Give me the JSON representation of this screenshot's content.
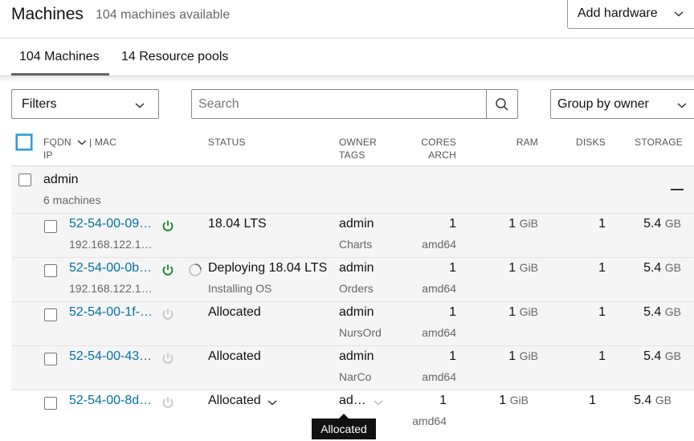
{
  "header": {
    "title": "Machines",
    "subtitle": "104 machines available",
    "add_hardware_label": "Add hardware"
  },
  "tabs": [
    {
      "label": "104 Machines",
      "active": true
    },
    {
      "label": "14 Resource pools",
      "active": false
    }
  ],
  "toolbar": {
    "filters_label": "Filters",
    "search_placeholder": "Search",
    "group_by_label": "Group by owner"
  },
  "table_header": {
    "fqdn": "FQDN",
    "mac": "| MAC",
    "ip": "IP",
    "status": "STATUS",
    "owner": "OWNER",
    "tags": "TAGS",
    "cores": "CORES",
    "arch": "ARCH",
    "ram": "RAM",
    "disks": "DISKS",
    "storage": "STORAGE"
  },
  "group": {
    "name": "admin",
    "count": "6 machines"
  },
  "rows": [
    {
      "fqdn": "52-54-00-09…",
      "ip": "192.168.122.1…",
      "power": "on",
      "status": "18.04 LTS",
      "status_sub": "",
      "owner": "admin",
      "tag": "Charts",
      "cores": "1",
      "arch": "amd64",
      "ram": "1",
      "ram_unit": "GiB",
      "disks": "1",
      "storage": "5.4",
      "storage_unit": "GB"
    },
    {
      "fqdn": "52-54-00-0b…",
      "ip": "192.168.122.1…",
      "power": "on",
      "status": "Deploying 18.04 LTS",
      "status_sub": "Installing OS",
      "owner": "admin",
      "tag": "Orders",
      "cores": "1",
      "arch": "amd64",
      "ram": "1",
      "ram_unit": "GiB",
      "disks": "1",
      "storage": "5.4",
      "storage_unit": "GB"
    },
    {
      "fqdn": "52-54-00-1f-…",
      "ip": "",
      "power": "off",
      "status": "Allocated",
      "status_sub": "",
      "owner": "admin",
      "tag": "NursOrd",
      "cores": "1",
      "arch": "amd64",
      "ram": "1",
      "ram_unit": "GiB",
      "disks": "1",
      "storage": "5.4",
      "storage_unit": "GB"
    },
    {
      "fqdn": "52-54-00-43…",
      "ip": "",
      "power": "off",
      "status": "Allocated",
      "status_sub": "",
      "owner": "admin",
      "tag": "NarCo",
      "cores": "1",
      "arch": "amd64",
      "ram": "1",
      "ram_unit": "GiB",
      "disks": "1",
      "storage": "5.4",
      "storage_unit": "GB"
    },
    {
      "fqdn": "52-54-00-8d…",
      "ip": "",
      "power": "off",
      "status": "Allocated",
      "status_sub": "",
      "owner": "ad…",
      "tag": "",
      "cores": "1",
      "arch": "amd64",
      "ram": "1",
      "ram_unit": "GiB",
      "disks": "1",
      "storage": "5.4",
      "storage_unit": "GB"
    }
  ],
  "tooltip": "Allocated",
  "colors": {
    "link": "#00739f",
    "power_on": "#0e8420",
    "power_off": "#c7c7c7",
    "focus": "#2d9cdb"
  },
  "icons": {
    "chevron": "chevron-down-icon",
    "search": "search-icon",
    "power": "power-icon",
    "spinner": "spinner-icon"
  }
}
